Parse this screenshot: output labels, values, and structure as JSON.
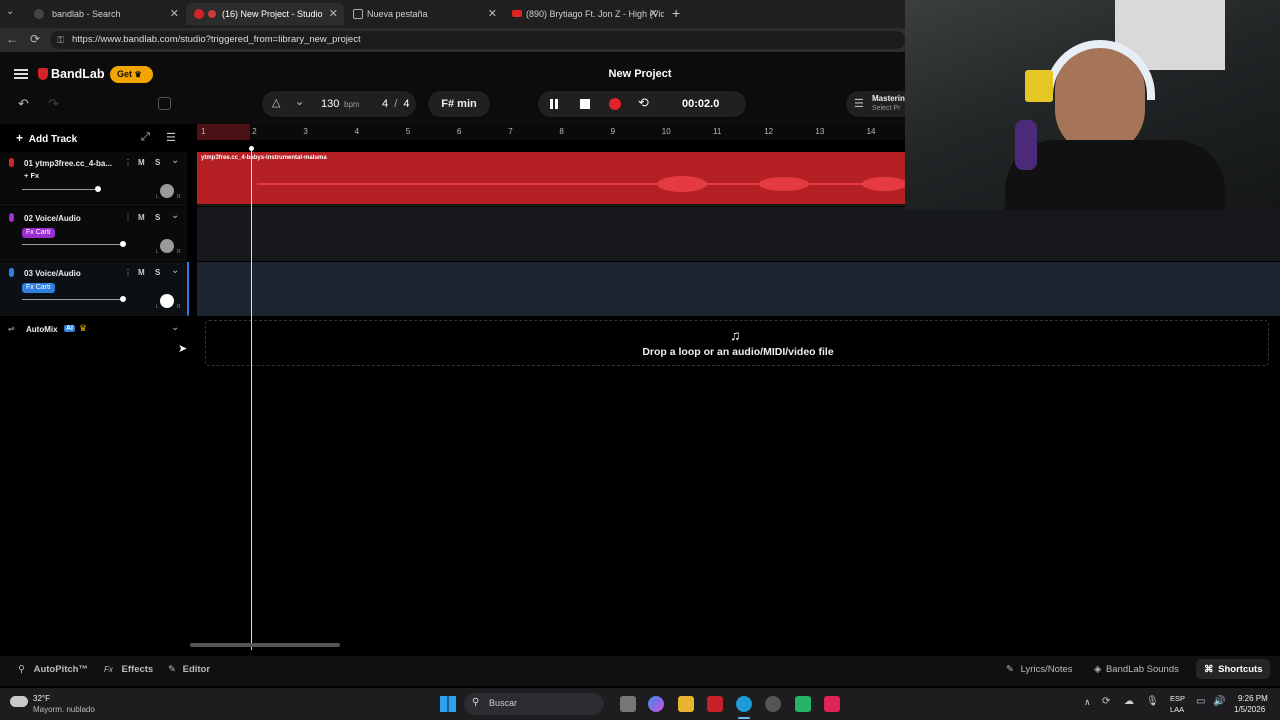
{
  "browser": {
    "tabs": [
      {
        "title": "bandlab - Search"
      },
      {
        "title": "(16) New Project - Studio"
      },
      {
        "title": "Nueva pestaña"
      },
      {
        "title": "(890) Brytiago Ft. Jon Z - High (Vid"
      }
    ],
    "url": "https://www.bandlab.com/studio?triggered_from=library_new_project"
  },
  "app": {
    "brand": "BandLab",
    "get_label": "Get",
    "project_title": "New Project",
    "bpm_value": "130",
    "bpm_unit": "bpm",
    "time_sig_num": "4",
    "time_sig_sep": "/",
    "time_sig_den": "4",
    "key": "F# min",
    "time": "00:02.0",
    "mastering_label": "Masterin",
    "mastering_sub": "Select Pr",
    "add_track": "Add Track",
    "ruler_ticks": [
      "1",
      "2",
      "3",
      "4",
      "5",
      "6",
      "7",
      "8",
      "9",
      "10",
      "11",
      "12",
      "13",
      "14"
    ],
    "tracks": [
      {
        "name": "01  ytmp3free.cc_4-ba...",
        "fx": "+ Fx",
        "mute": "M",
        "solo": "S",
        "clip": "ytmp3free.cc_4-babys-instrumental-maluma"
      },
      {
        "name": "02  Voice/Audio",
        "fx": "Fx Carti",
        "mute": "M",
        "solo": "S"
      },
      {
        "name": "03  Voice/Audio",
        "fx": "Fx Carti",
        "mute": "M",
        "solo": "S"
      }
    ],
    "pan_l": "L",
    "pan_r": "R",
    "automix": "AutoMix",
    "ai_badge": "AI",
    "drop_text": "Drop a loop or an audio/MIDI/video file",
    "bottom": {
      "autopitch": "AutoPitch™",
      "effects": "Effects",
      "fx_prefix": "Fx",
      "editor": "Editor",
      "lyrics": "Lyrics/Notes",
      "sounds": "BandLab Sounds",
      "shortcuts": "Shortcuts"
    }
  },
  "taskbar": {
    "temp": "32°F",
    "weather": "Mayorm. nublado",
    "search": "Buscar",
    "lang1": "ESP",
    "lang2": "LAA",
    "clock": "9:26 PM",
    "date": "1/5/2026"
  },
  "colors": {
    "accent_red": "#d2232a",
    "fx_purple": "#9b2fd1",
    "fx_blue": "#2f7fe0",
    "get_yellow": "#f2a500"
  }
}
